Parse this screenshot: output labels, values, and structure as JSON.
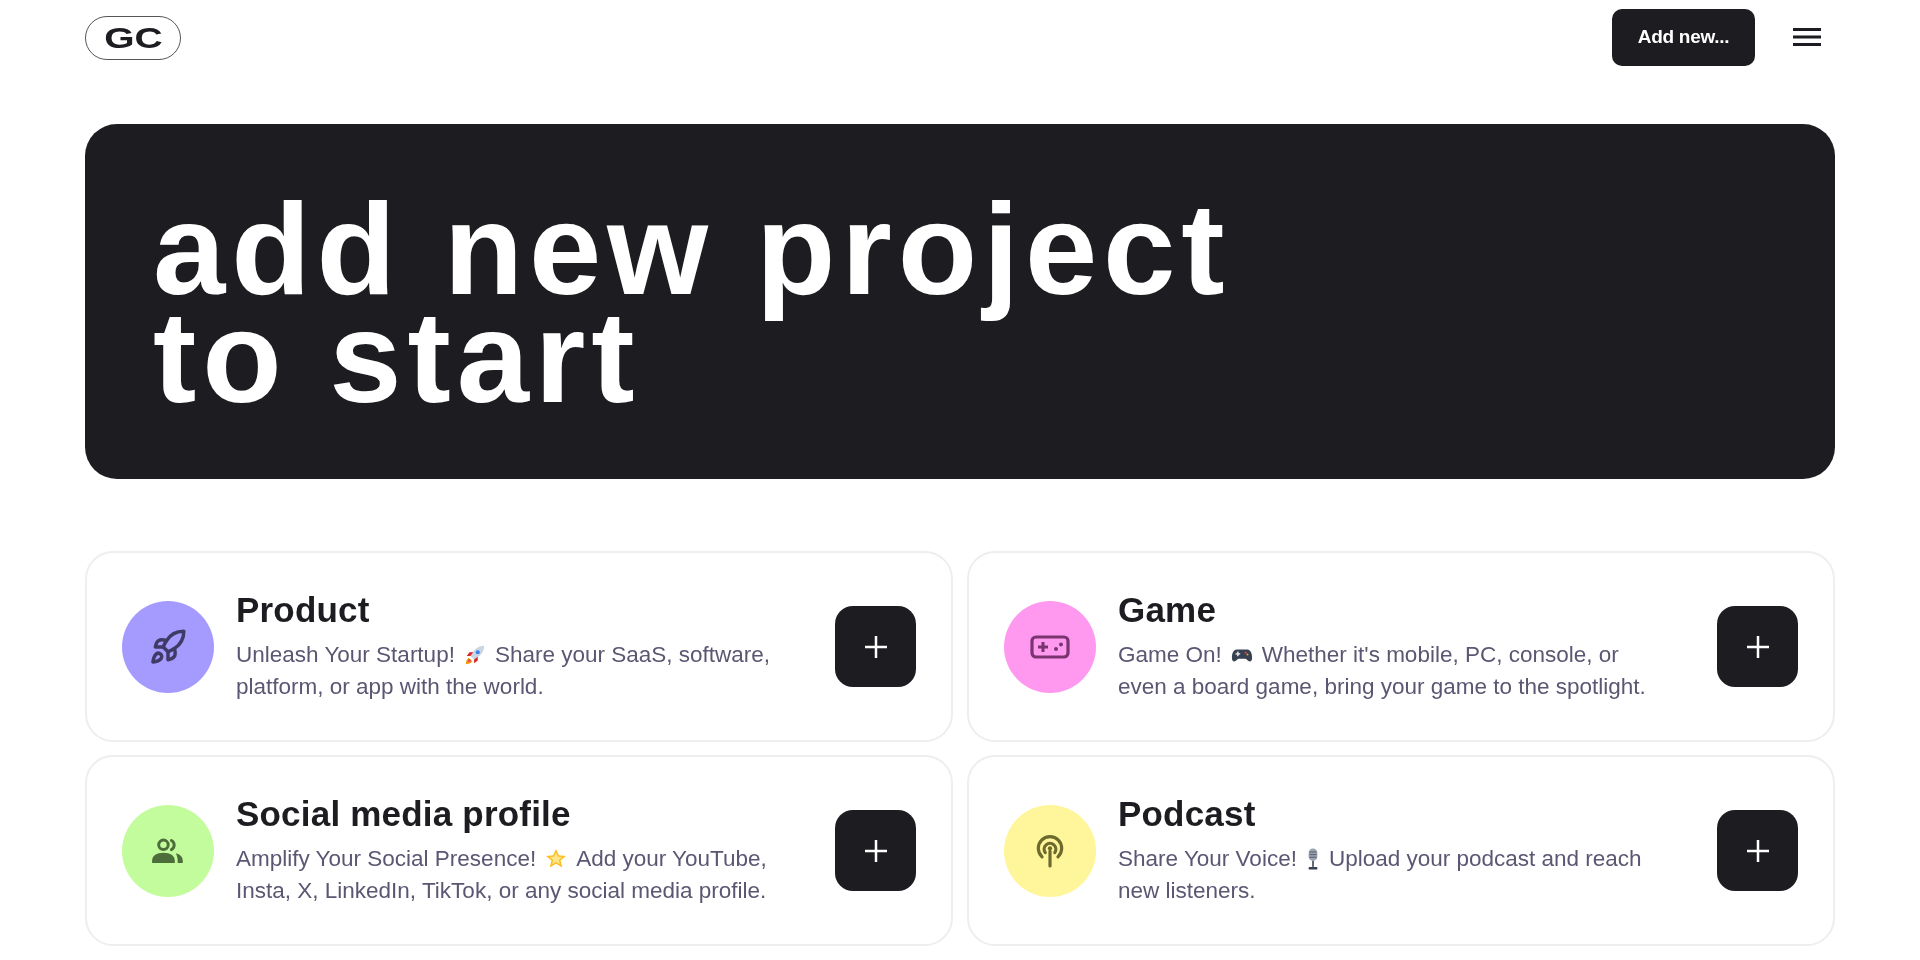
{
  "header": {
    "logo": "GC",
    "add_button": "Add new..."
  },
  "hero": {
    "heading_lines": [
      "add new project",
      "to start"
    ]
  },
  "project_types": [
    {
      "kind": "product",
      "title": "Product",
      "lead": "Unleash Your Startup!",
      "text_lines": [
        "Share your SaaS, software,",
        "platform, or app with the world."
      ],
      "color": "#a59bff"
    },
    {
      "kind": "game",
      "title": "Game",
      "lead": "Game On!",
      "text_lines": [
        "Whether it's mobile, PC, console, or",
        "even a board game, bring your game to the spotlight."
      ],
      "color": "#ff99ef"
    },
    {
      "kind": "social",
      "title": "Social media profile",
      "lead": "Amplify Your Social Presence!",
      "text_lines": [
        "Add your YouTube,",
        "Insta, X, LinkedIn, TikTok, or any social media profile."
      ],
      "color": "#c3fc9c"
    },
    {
      "kind": "podcast",
      "title": "Podcast",
      "lead": "Share Your Voice!",
      "text_lines": [
        "Upload your podcast and reach",
        "new listeners."
      ],
      "color": "#fff59a"
    }
  ]
}
